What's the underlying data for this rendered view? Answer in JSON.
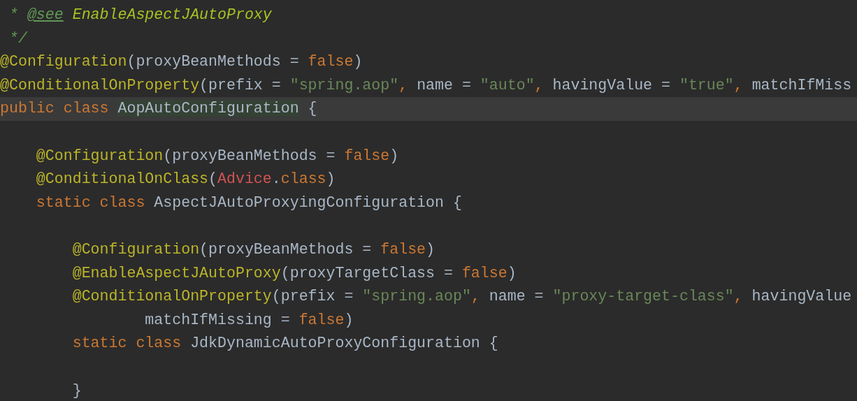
{
  "editor": {
    "lines": [
      {
        "current": false,
        "tokens": [
          {
            "kind": "comment",
            "text": " * "
          },
          {
            "kind": "doctag",
            "text": "@see"
          },
          {
            "kind": "docref",
            "text": " EnableAspectJAutoProxy"
          }
        ]
      },
      {
        "current": false,
        "tokens": [
          {
            "kind": "comment",
            "text": " */"
          }
        ]
      },
      {
        "current": false,
        "tokens": [
          {
            "kind": "annotation",
            "text": "@Configuration"
          },
          {
            "kind": "plain",
            "text": "(proxyBeanMethods = "
          },
          {
            "kind": "keyword",
            "text": "false"
          },
          {
            "kind": "plain",
            "text": ")"
          }
        ]
      },
      {
        "current": false,
        "tokens": [
          {
            "kind": "annotation",
            "text": "@ConditionalOnProperty"
          },
          {
            "kind": "plain",
            "text": "(prefix = "
          },
          {
            "kind": "string",
            "text": "\"spring.aop\""
          },
          {
            "kind": "keyword",
            "text": ", "
          },
          {
            "kind": "plain",
            "text": "name = "
          },
          {
            "kind": "string",
            "text": "\"auto\""
          },
          {
            "kind": "keyword",
            "text": ", "
          },
          {
            "kind": "plain",
            "text": "havingValue = "
          },
          {
            "kind": "string",
            "text": "\"true\""
          },
          {
            "kind": "keyword",
            "text": ", "
          },
          {
            "kind": "plain",
            "text": "matchIfMiss"
          }
        ]
      },
      {
        "current": true,
        "tokens": [
          {
            "kind": "keyword",
            "text": "public class "
          },
          {
            "kind": "highlighted",
            "text": "AopAutoConfiguration"
          },
          {
            "kind": "plain",
            "text": " {"
          }
        ]
      },
      {
        "current": false
      },
      {
        "current": false,
        "tokens": [
          {
            "kind": "annotation",
            "text": "    @Configuration"
          },
          {
            "kind": "plain",
            "text": "(proxyBeanMethods = "
          },
          {
            "kind": "keyword",
            "text": "false"
          },
          {
            "kind": "plain",
            "text": ")"
          }
        ]
      },
      {
        "current": false,
        "tokens": [
          {
            "kind": "annotation",
            "text": "    @ConditionalOnClass"
          },
          {
            "kind": "plain",
            "text": "("
          },
          {
            "kind": "error",
            "text": "Advice"
          },
          {
            "kind": "plain",
            "text": "."
          },
          {
            "kind": "keyword",
            "text": "class"
          },
          {
            "kind": "plain",
            "text": ")"
          }
        ]
      },
      {
        "current": false,
        "tokens": [
          {
            "kind": "keyword",
            "text": "    static class "
          },
          {
            "kind": "plain",
            "text": "AspectJAutoProxyingConfiguration {"
          }
        ]
      },
      {
        "current": false
      },
      {
        "current": false,
        "tokens": [
          {
            "kind": "annotation",
            "text": "        @Configuration"
          },
          {
            "kind": "plain",
            "text": "(proxyBeanMethods = "
          },
          {
            "kind": "keyword",
            "text": "false"
          },
          {
            "kind": "plain",
            "text": ")"
          }
        ]
      },
      {
        "current": false,
        "tokens": [
          {
            "kind": "annotation",
            "text": "        @EnableAspectJAutoProxy"
          },
          {
            "kind": "plain",
            "text": "(proxyTargetClass = "
          },
          {
            "kind": "keyword",
            "text": "false"
          },
          {
            "kind": "plain",
            "text": ")"
          }
        ]
      },
      {
        "current": false,
        "tokens": [
          {
            "kind": "annotation",
            "text": "        @ConditionalOnProperty"
          },
          {
            "kind": "plain",
            "text": "(prefix = "
          },
          {
            "kind": "string",
            "text": "\"spring.aop\""
          },
          {
            "kind": "keyword",
            "text": ", "
          },
          {
            "kind": "plain",
            "text": "name = "
          },
          {
            "kind": "string",
            "text": "\"proxy-target-class\""
          },
          {
            "kind": "keyword",
            "text": ", "
          },
          {
            "kind": "plain",
            "text": "havingValue"
          }
        ]
      },
      {
        "current": false,
        "tokens": [
          {
            "kind": "plain",
            "text": "                matchIfMissing = "
          },
          {
            "kind": "keyword",
            "text": "false"
          },
          {
            "kind": "plain",
            "text": ")"
          }
        ]
      },
      {
        "current": false,
        "tokens": [
          {
            "kind": "keyword",
            "text": "        static class "
          },
          {
            "kind": "plain",
            "text": "JdkDynamicAutoProxyConfiguration {"
          }
        ]
      },
      {
        "current": false
      },
      {
        "current": false,
        "tokens": [
          {
            "kind": "plain",
            "text": "        }"
          }
        ]
      }
    ]
  }
}
